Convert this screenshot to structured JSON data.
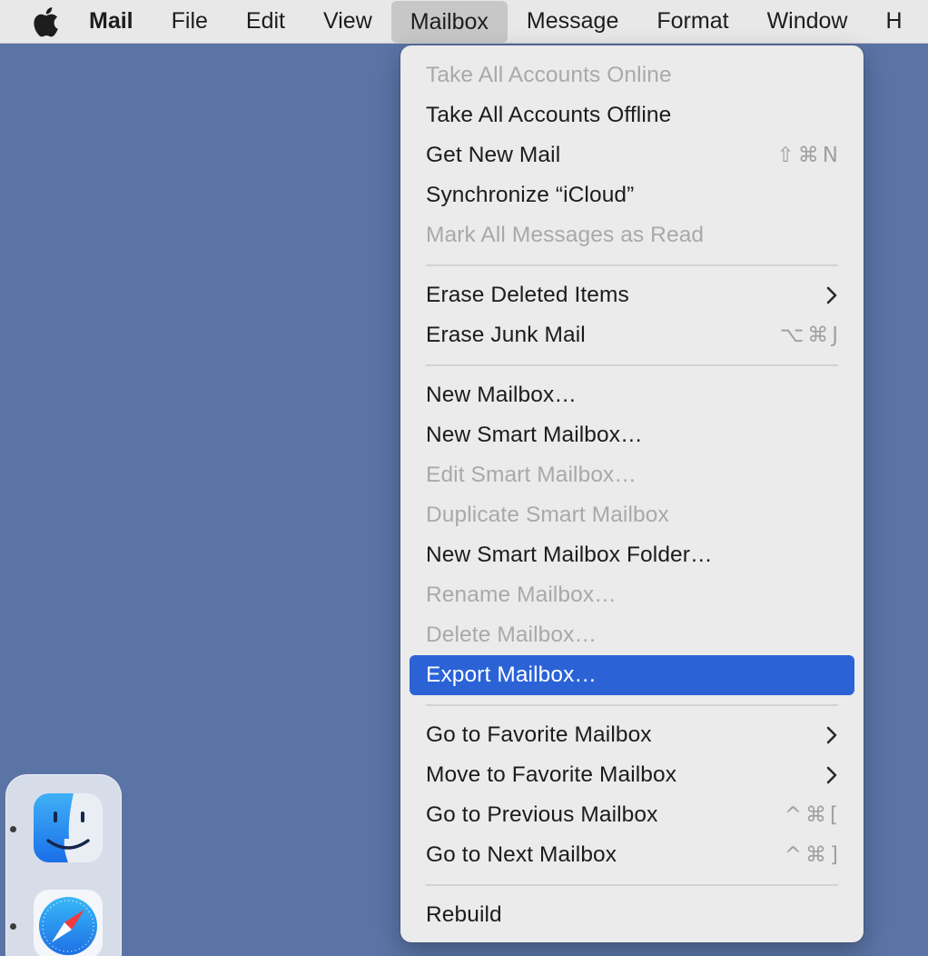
{
  "menubar": {
    "apple_icon": "apple-logo-icon",
    "items": [
      {
        "label": "Mail"
      },
      {
        "label": "File"
      },
      {
        "label": "Edit"
      },
      {
        "label": "View"
      },
      {
        "label": "Mailbox"
      },
      {
        "label": "Message"
      },
      {
        "label": "Format"
      },
      {
        "label": "Window"
      },
      {
        "label": "H"
      }
    ]
  },
  "menu": {
    "items": [
      {
        "label": "Take All Accounts Online",
        "enabled": false
      },
      {
        "label": "Take All Accounts Offline",
        "enabled": true
      },
      {
        "label": "Get New Mail",
        "shortcut": "⇧⌘N",
        "enabled": true
      },
      {
        "label": "Synchronize “iCloud”",
        "enabled": true
      },
      {
        "label": "Mark All Messages as Read",
        "enabled": false
      },
      {
        "label": "Erase Deleted Items",
        "submenu": true,
        "enabled": true
      },
      {
        "label": "Erase Junk Mail",
        "shortcut": "⌥⌘J",
        "enabled": true
      },
      {
        "label": "New Mailbox…",
        "enabled": true
      },
      {
        "label": "New Smart Mailbox…",
        "enabled": true
      },
      {
        "label": "Edit Smart Mailbox…",
        "enabled": false
      },
      {
        "label": "Duplicate Smart Mailbox",
        "enabled": false
      },
      {
        "label": "New Smart Mailbox Folder…",
        "enabled": true
      },
      {
        "label": "Rename Mailbox…",
        "enabled": false
      },
      {
        "label": "Delete Mailbox…",
        "enabled": false
      },
      {
        "label": "Export Mailbox…",
        "enabled": true,
        "highlighted": true
      },
      {
        "label": "Go to Favorite Mailbox",
        "submenu": true,
        "enabled": true
      },
      {
        "label": "Move to Favorite Mailbox",
        "submenu": true,
        "enabled": true
      },
      {
        "label": "Go to Previous Mailbox",
        "shortcut": "^⌘[",
        "enabled": true
      },
      {
        "label": "Go to Next Mailbox",
        "shortcut": "^⌘]",
        "enabled": true
      },
      {
        "label": "Rebuild",
        "enabled": true
      }
    ]
  },
  "dock": {
    "apps": [
      {
        "icon": "finder-icon",
        "running": true
      },
      {
        "icon": "safari-icon",
        "running": true
      }
    ]
  },
  "colors": {
    "desktop": "#5a74a6",
    "menu_background": "#ebebeb",
    "highlight": "#2b62d6",
    "disabled_text": "#a9a9a9"
  }
}
